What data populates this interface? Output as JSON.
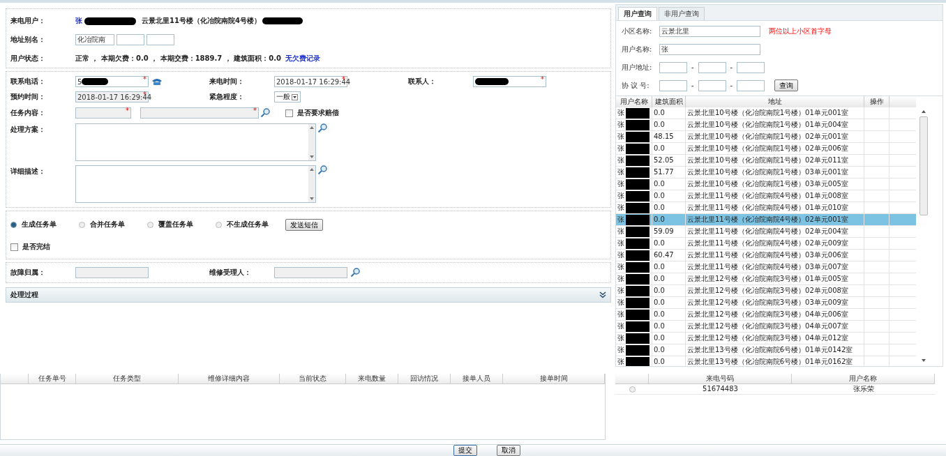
{
  "caller": {
    "label": "来电用户：",
    "name": "张",
    "address": "云景北里11号楼（化冶院南院4号楼）"
  },
  "alias": {
    "label": "地址别名：",
    "value": "化冶院南"
  },
  "status": {
    "label": "用户状态：",
    "text": "正常 ， 本期欠费：0.0 ， 本期交费：1889.7 ， 建筑面积：0.0",
    "link": "无欠费记录"
  },
  "phone": {
    "label": "联系电话：",
    "value": "5",
    "mark": "*"
  },
  "call_time": {
    "label": "来电时间：",
    "value": "2018-01-17 16:29:44",
    "mark": "*"
  },
  "contact_person": {
    "label": "联系人：",
    "mark": "*"
  },
  "appointment": {
    "label": "预约时间：",
    "value": "2018-01-17 16:29:44",
    "mark": "*"
  },
  "urgency": {
    "label": "紧急程度：",
    "value": "一般"
  },
  "task_content": {
    "label": "任务内容：",
    "marks": [
      "*",
      "*"
    ]
  },
  "compensation": {
    "label": "是否要求赔偿",
    "checked": false
  },
  "plan": {
    "label": "处理方案："
  },
  "detail": {
    "label": "详细描述："
  },
  "task_options": [
    {
      "label": "生成任务单",
      "selected": true
    },
    {
      "label": "合并任务单",
      "selected": false
    },
    {
      "label": "覆盖任务单",
      "selected": false
    },
    {
      "label": "不生成任务单",
      "selected": false
    }
  ],
  "sms_button": "发送短信",
  "finished": {
    "label": "是否完结",
    "checked": false
  },
  "fault": {
    "label": "故障归属："
  },
  "repairer": {
    "label": "维修受理人："
  },
  "process_bar": {
    "title": "处理过程",
    "expanded": false
  },
  "query": {
    "tabs": [
      {
        "label": "用户查询",
        "selected": true
      },
      {
        "label": "非用户查询",
        "selected": false
      }
    ],
    "community": {
      "label": "小区名称:",
      "value": "云景北里",
      "hint": "两位以上小区首字母"
    },
    "user_name": {
      "label": "用户名称:",
      "value": "张"
    },
    "address": {
      "label": "用户地址:",
      "separators": [
        "-",
        "-"
      ]
    },
    "agreement": {
      "label": "协 议 号:",
      "separators": [
        "-",
        "-"
      ]
    },
    "button": "查询"
  },
  "results": {
    "columns": [
      "用户名称",
      "建筑面积",
      "地址",
      "操作"
    ],
    "rows": [
      {
        "name": "张",
        "area": "0.0",
        "address": "云景北里10号楼（化冶院南院1号楼）01单元001室",
        "selected": false
      },
      {
        "name": "张",
        "area": "0.0",
        "address": "云景北里10号楼（化冶院南院1号楼）01单元004室",
        "selected": false
      },
      {
        "name": "张",
        "area": "48.15",
        "address": "云景北里10号楼（化冶院南院1号楼）02单元001室",
        "selected": false
      },
      {
        "name": "张",
        "area": "0.0",
        "address": "云景北里10号楼（化冶院南院1号楼）02单元006室",
        "selected": false
      },
      {
        "name": "张",
        "area": "52.05",
        "address": "云景北里10号楼（化冶院南院1号楼）02单元011室",
        "selected": false
      },
      {
        "name": "张",
        "area": "51.77",
        "address": "云景北里10号楼（化冶院南院1号楼）03单元001室",
        "selected": false
      },
      {
        "name": "张",
        "area": "0.0",
        "address": "云景北里10号楼（化冶院南院1号楼）03单元005室",
        "selected": false
      },
      {
        "name": "张",
        "area": "0.0",
        "address": "云景北里11号楼（化冶院南院4号楼）01单元008室",
        "selected": false
      },
      {
        "name": "张",
        "area": "0.0",
        "address": "云景北里11号楼（化冶院南院4号楼）01单元010室",
        "selected": false
      },
      {
        "name": "张",
        "area": "0.0",
        "address": "云景北里11号楼（化冶院南院4号楼）02单元001室",
        "selected": true
      },
      {
        "name": "张",
        "area": "59.09",
        "address": "云景北里11号楼（化冶院南院4号楼）02单元004室",
        "selected": false
      },
      {
        "name": "张",
        "area": "0.0",
        "address": "云景北里11号楼（化冶院南院4号楼）02单元009室",
        "selected": false
      },
      {
        "name": "张",
        "area": "60.47",
        "address": "云景北里11号楼（化冶院南院4号楼）03单元006室",
        "selected": false
      },
      {
        "name": "张",
        "area": "0.0",
        "address": "云景北里11号楼（化冶院南院4号楼）03单元007室",
        "selected": false
      },
      {
        "name": "张",
        "area": "0.0",
        "address": "云景北里12号楼（化冶院南院3号楼）01单元005室",
        "selected": false
      },
      {
        "name": "张",
        "area": "0.0",
        "address": "云景北里12号楼（化冶院南院3号楼）02单元008室",
        "selected": false
      },
      {
        "name": "张",
        "area": "0.0",
        "address": "云景北里12号楼（化冶院南院3号楼）03单元009室",
        "selected": false
      },
      {
        "name": "张",
        "area": "0.0",
        "address": "云景北里12号楼（化冶院南院3号楼）04单元006室",
        "selected": false
      },
      {
        "name": "张",
        "area": "0.0",
        "address": "云景北里12号楼（化冶院南院3号楼）04单元007室",
        "selected": false
      },
      {
        "name": "张",
        "area": "0.0",
        "address": "云景北里12号楼（化冶院南院3号楼）04单元012室",
        "selected": false
      },
      {
        "name": "张",
        "area": "0.0",
        "address": "云景北里13号楼（化冶院南院6号楼）01单元0142室",
        "selected": false
      },
      {
        "name": "张",
        "area": "0.0",
        "address": "云景北里13号楼（化冶院南院6号楼）01单元0162室",
        "selected": false
      }
    ]
  },
  "tasks": {
    "columns": [
      "任务单号",
      "任务类型",
      "维修详细内容",
      "当前状态",
      "来电数量",
      "回访情况",
      "接单人员",
      "接单时间"
    ]
  },
  "calls": {
    "columns": [
      "来电号码",
      "用户名称"
    ],
    "rows": [
      {
        "selected": false,
        "number": "51674483",
        "name": "张乐荣"
      }
    ]
  },
  "actions": [
    "提交",
    "取消"
  ]
}
